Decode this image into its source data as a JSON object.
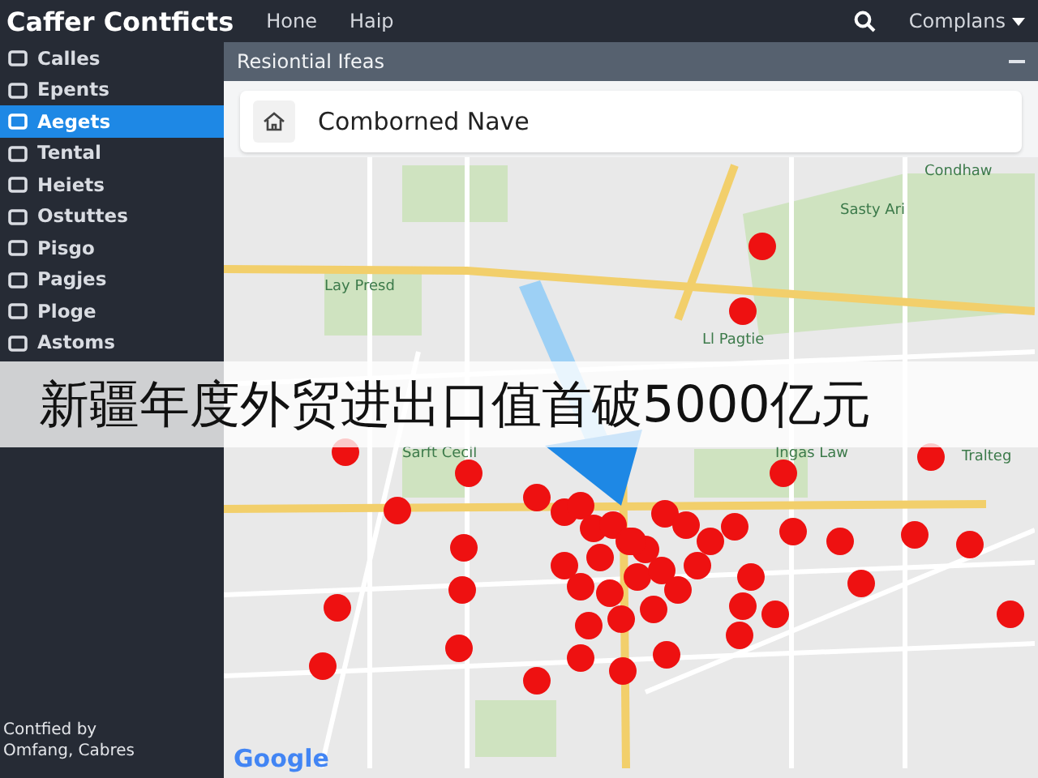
{
  "header": {
    "title": "Caffer Contficts",
    "nav": [
      {
        "label": "Hone"
      },
      {
        "label": "Haip"
      }
    ],
    "account": "Complans"
  },
  "sidebar": {
    "items": [
      {
        "label": "Calles",
        "selected": false
      },
      {
        "label": "Epents",
        "selected": false
      },
      {
        "label": "Aegets",
        "selected": true
      },
      {
        "label": "Tental",
        "selected": false
      },
      {
        "label": "Heiets",
        "selected": false
      },
      {
        "label": "Ostuttes",
        "selected": false
      },
      {
        "label": "Pisgo",
        "selected": false
      },
      {
        "label": "Pagjes",
        "selected": false
      },
      {
        "label": "Ploge",
        "selected": false
      },
      {
        "label": "Astoms",
        "selected": false
      }
    ],
    "footer": [
      "Contfied by",
      "Omfang, Cabres"
    ]
  },
  "panel": {
    "title": "Resiontial Ifeas",
    "search": {
      "value": "Comborned Nave"
    },
    "map": {
      "labels": [
        {
          "text": "Lay Presd"
        },
        {
          "text": "Sasty Ari"
        },
        {
          "text": "Condhaw"
        },
        {
          "text": "Ll Pagtie"
        },
        {
          "text": "Sarft Cecil"
        },
        {
          "text": "Ingas Law"
        },
        {
          "text": "Tralteg"
        }
      ],
      "attribution": "Google"
    }
  },
  "banner": {
    "text": "新疆年度外贸进出口值首破5000亿元"
  }
}
